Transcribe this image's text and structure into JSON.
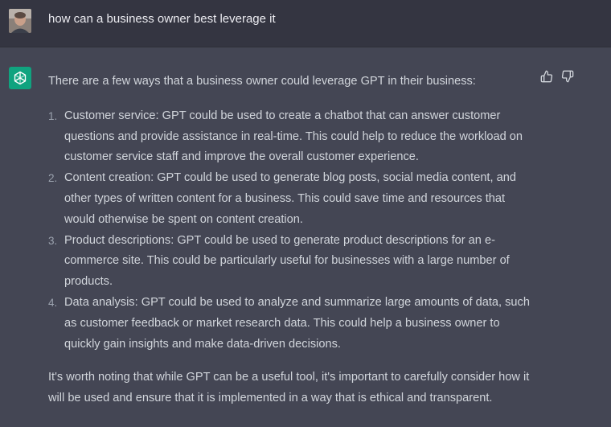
{
  "user_message": {
    "text": "how can a business owner best leverage it",
    "avatar_icon": "user-avatar"
  },
  "assistant_message": {
    "logo_icon": "openai-logo-icon",
    "intro": "There are a few ways that a business owner could leverage GPT in their business:",
    "items": [
      {
        "number": "1.",
        "text": "Customer service: GPT could be used to create a chatbot that can answer customer questions and provide assistance in real-time. This could help to reduce the workload on customer service staff and improve the overall customer experience."
      },
      {
        "number": "2.",
        "text": "Content creation: GPT could be used to generate blog posts, social media content, and other types of written content for a business. This could save time and resources that would otherwise be spent on content creation."
      },
      {
        "number": "3.",
        "text": "Product descriptions: GPT could be used to generate product descriptions for an e-commerce site. This could be particularly useful for businesses with a large number of products."
      },
      {
        "number": "4.",
        "text": "Data analysis: GPT could be used to analyze and summarize large amounts of data, such as customer feedback or market research data. This could help a business owner to quickly gain insights and make data-driven decisions."
      }
    ],
    "outro": "It's worth noting that while GPT can be a useful tool, it's important to carefully consider how it will be used and ensure that it is implemented in a way that is ethical and transparent."
  },
  "feedback": {
    "thumbs_up_icon": "thumbs-up-icon",
    "thumbs_down_icon": "thumbs-down-icon"
  },
  "colors": {
    "user_bg": "#343541",
    "assistant_bg": "#444654",
    "brand_green": "#10a37f",
    "text": "#d1d5db"
  }
}
